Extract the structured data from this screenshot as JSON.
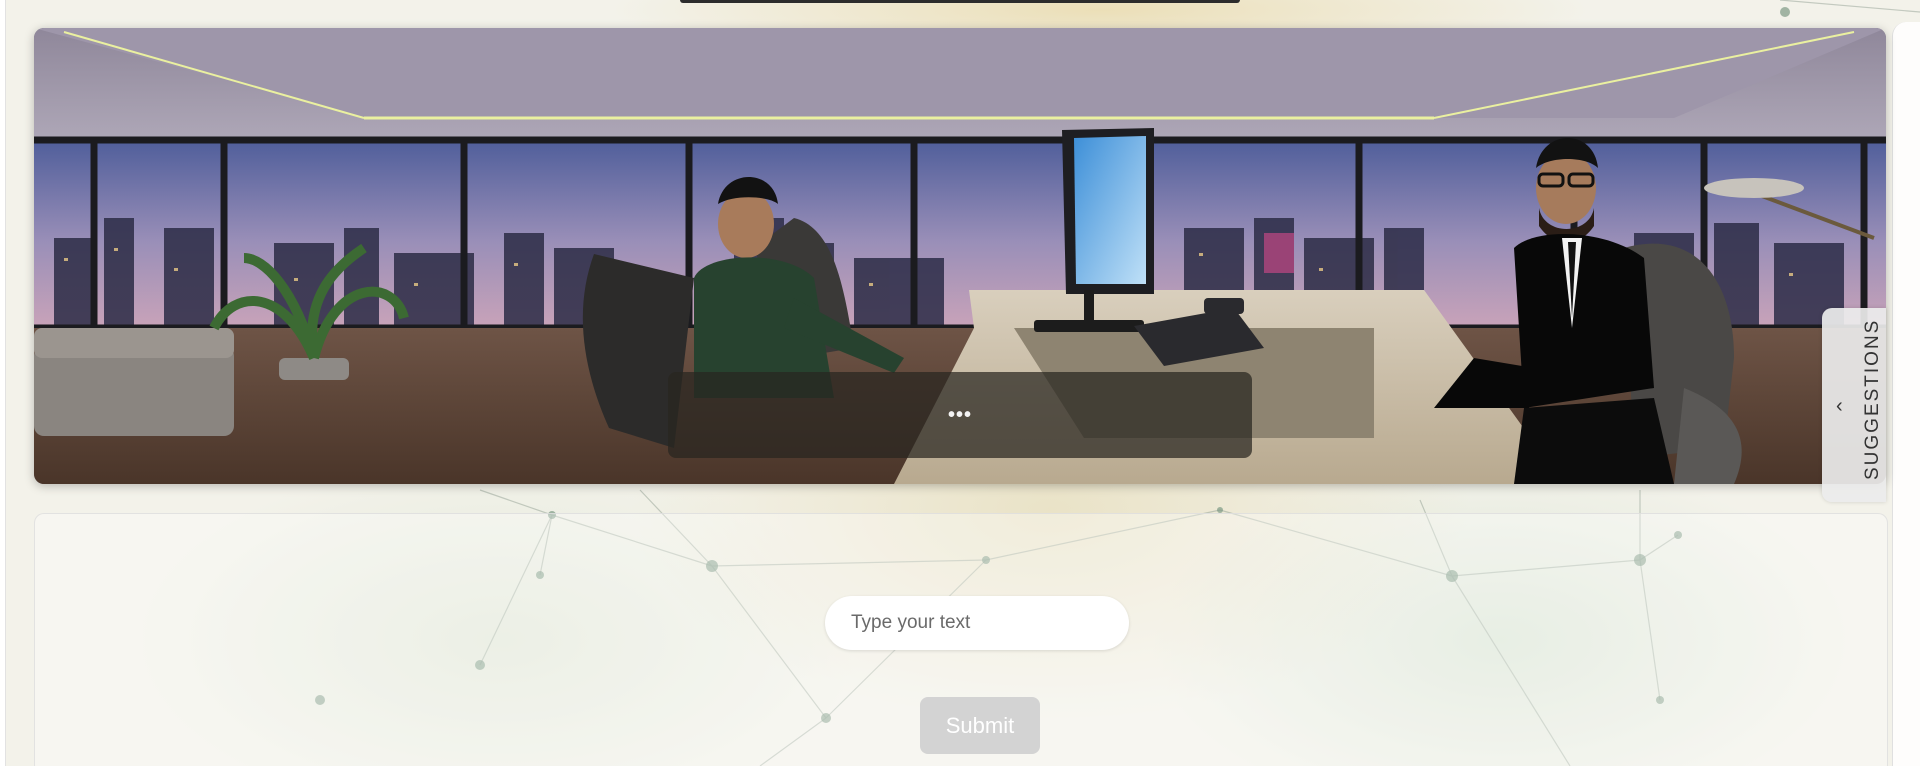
{
  "scene": {
    "caption_text": "•••"
  },
  "suggestions_tab": {
    "label": "SUGGESTIONS",
    "icon": "chevron-left-icon"
  },
  "input": {
    "placeholder": "Type your text",
    "value": ""
  },
  "submit": {
    "label": "Submit"
  },
  "colors": {
    "submit_bg": "#d3d3d3",
    "caption_bg": "#28261f",
    "accent_ceiling": "#eaf0a0"
  }
}
